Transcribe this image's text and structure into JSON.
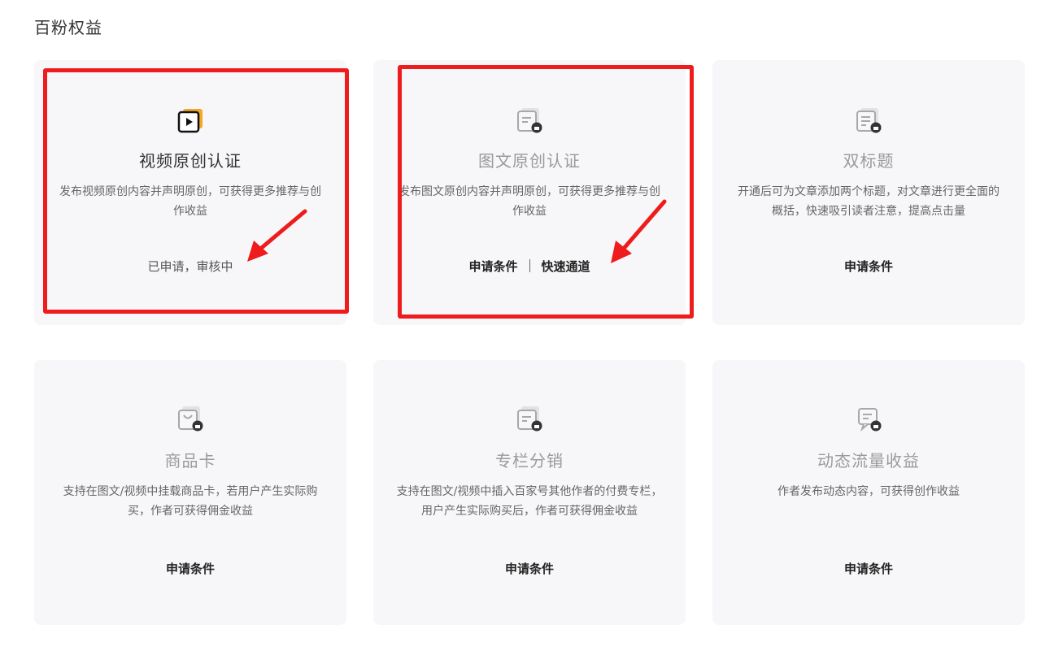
{
  "page": {
    "title": "百粉权益"
  },
  "cards": [
    {
      "title": "视频原创认证",
      "desc": "发布视频原创内容并声明原创，可获得更多推荐与创作收益",
      "status": "已申请，审核中",
      "icon": "video-play-icon",
      "accent": "#f5a623"
    },
    {
      "title": "图文原创认证",
      "desc": "发布图文原创内容并声明原创，可获得更多推荐与创作收益",
      "link1": "申请条件",
      "link2": "快速通道",
      "icon": "article-lock-icon"
    },
    {
      "title": "双标题",
      "desc": "开通后可为文章添加两个标题，对文章进行更全面的概括，快速吸引读者注意，提高点击量",
      "link1": "申请条件",
      "icon": "double-title-lock-icon"
    },
    {
      "title": "商品卡",
      "desc": "支持在图文/视频中挂载商品卡，若用户产生实际购买，作者可获得佣金收益",
      "link1": "申请条件",
      "icon": "shopping-bag-lock-icon"
    },
    {
      "title": "专栏分销",
      "desc": "支持在图文/视频中插入百家号其他作者的付费专栏，用户产生实际购买后，作者可获得佣金收益",
      "link1": "申请条件",
      "icon": "column-lock-icon"
    },
    {
      "title": "动态流量收益",
      "desc": "作者发布动态内容，可获得创作收益",
      "link1": "申请条件",
      "icon": "dynamic-lock-icon"
    }
  ],
  "colors": {
    "highlight": "#ee1c1c",
    "card_bg": "#f7f7f9"
  }
}
